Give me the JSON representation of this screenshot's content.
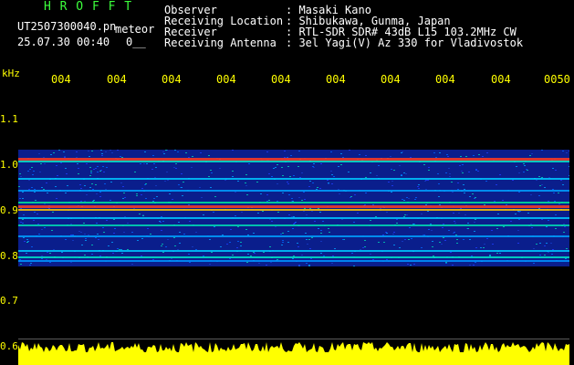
{
  "header": {
    "brand": "H R O F F T",
    "filename": "UT2507300040.pn",
    "meteor_label": "meteor",
    "datetime": "25.07.30 00:40",
    "counter": "0__"
  },
  "info": [
    {
      "key": "Observer",
      "value": ": Masaki Kano"
    },
    {
      "key": "Receiving Location",
      "value": ": Shibukawa, Gunma, Japan"
    },
    {
      "key": "Receiver",
      "value": ": RTL-SDR SDR# 43dB L15 103.2MHz CW"
    },
    {
      "key": "Receiving Antenna",
      "value": ": 3el Yagi(V) Az 330 for Vladivostok"
    }
  ],
  "axis": {
    "y_unit": "kHz",
    "y_ticks": [
      "1.1",
      "1.0",
      "0.9",
      "0.8",
      "0.7",
      "0.6"
    ],
    "x_ticks": [
      "004",
      "004",
      "004",
      "004",
      "004",
      "004",
      "004",
      "004",
      "004",
      "0050"
    ]
  },
  "colors": {
    "label": "#ffff00",
    "brand": "#3cff3c",
    "background": "#000000",
    "spectrogram_base": "#0a1e8c",
    "band_hot": "#ff3c1e"
  }
}
